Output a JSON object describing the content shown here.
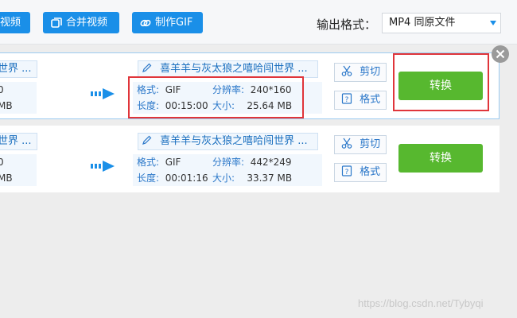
{
  "toolbar": {
    "buttons": [
      {
        "label": "视频",
        "icon": "video-icon"
      },
      {
        "label": "合并视频",
        "icon": "merge-icon"
      },
      {
        "label": "制作GIF",
        "icon": "gif-link-icon"
      }
    ],
    "output_format_label": "输出格式：",
    "output_format_value": "MP4  同原文件"
  },
  "tasks": [
    {
      "source_title": "世界 ...",
      "source_lines": [
        "0",
        "MB"
      ],
      "output_title": "喜羊羊与灰太狼之嘻哈闯世界 ...",
      "format_key": "格式:",
      "format_val": "GIF",
      "res_key": "分辨率:",
      "res_val": "240*160",
      "length_key": "长度:",
      "length_val": "00:15:00",
      "size_key": "大小:",
      "size_val": "25.64 MB",
      "cut_label": "剪切",
      "format_btn_label": "格式",
      "convert_label": "转换"
    },
    {
      "source_title": "世界 ...",
      "source_lines": [
        "0",
        "MB"
      ],
      "output_title": "喜羊羊与灰太狼之嘻哈闯世界 ...",
      "format_key": "格式:",
      "format_val": "GIF",
      "res_key": "分辨率:",
      "res_val": "442*249",
      "length_key": "长度:",
      "length_val": "00:01:16",
      "size_key": "大小:",
      "size_val": "33.37 MB",
      "cut_label": "剪切",
      "format_btn_label": "格式",
      "convert_label": "转换"
    }
  ],
  "watermark": "https://blog.csdn.net/Tybyqi",
  "colors": {
    "primary_blue": "#1a8fe8",
    "convert_green": "#57b82f",
    "highlight_red": "#e0353a"
  }
}
